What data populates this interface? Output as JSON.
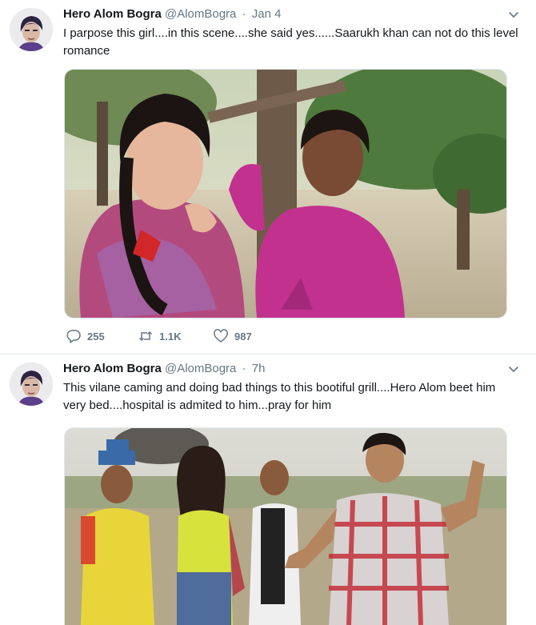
{
  "tweets": [
    {
      "author_name": "Hero Alom Bogra",
      "handle": "@AlomBogra",
      "separator": "·",
      "time": "Jan 4",
      "text": "I parpose this girl....in this scene....she said yes......Saarukh khan can not do this level romance",
      "stats": {
        "replies": "255",
        "retweets": "1.1K",
        "likes": "987"
      },
      "media_icon": "couple-photo"
    },
    {
      "author_name": "Hero Alom Bogra",
      "handle": "@AlomBogra",
      "separator": "·",
      "time": "7h",
      "text": "This vilane caming and doing bad things to this bootiful grill....Hero Alom beet him very bed....hospital is admited to him...pray for him",
      "media_icon": "group-photo"
    }
  ],
  "icons": {
    "avatar": "avatar-icon",
    "caret": "chevron-down-icon",
    "reply": "reply-icon",
    "retweet": "retweet-icon",
    "like": "heart-icon"
  },
  "colors": {
    "text": "#14171a",
    "secondary": "#657786",
    "divider": "#e6ecf0"
  }
}
